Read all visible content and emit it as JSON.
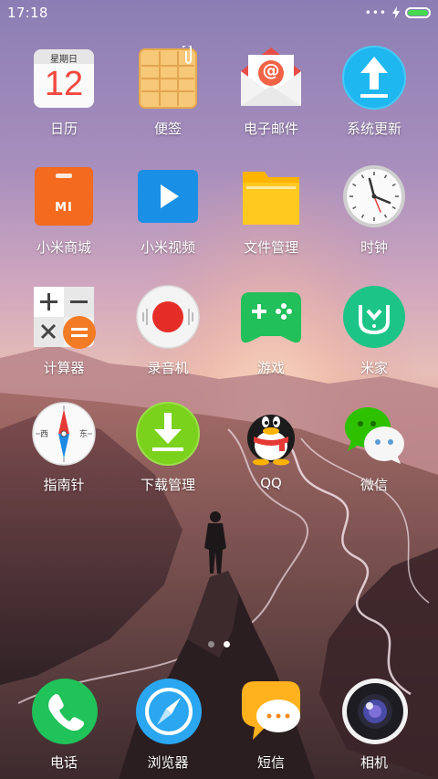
{
  "status_bar": {
    "time": "17:18",
    "signal_dots": "•••",
    "battery_level": 1.0,
    "battery_color": "#44d94f"
  },
  "home_screen": {
    "rows": [
      [
        {
          "label": "日历",
          "icon": "calendar-icon",
          "calendar_weekday": "星期日",
          "calendar_day": "12"
        },
        {
          "label": "便签",
          "icon": "notes-icon"
        },
        {
          "label": "电子邮件",
          "icon": "email-icon",
          "email_symbol": "@"
        },
        {
          "label": "系统更新",
          "icon": "system-update-icon"
        }
      ],
      [
        {
          "label": "小米商城",
          "icon": "mi-store-icon",
          "logo_text": "MI"
        },
        {
          "label": "小米视频",
          "icon": "video-icon"
        },
        {
          "label": "文件管理",
          "icon": "folder-icon"
        },
        {
          "label": "时钟",
          "icon": "clock-icon"
        }
      ],
      [
        {
          "label": "计算器",
          "icon": "calculator-icon"
        },
        {
          "label": "录音机",
          "icon": "recorder-icon"
        },
        {
          "label": "游戏",
          "icon": "game-icon"
        },
        {
          "label": "米家",
          "icon": "mijia-icon"
        }
      ],
      [
        {
          "label": "指南针",
          "icon": "compass-icon",
          "west": "西",
          "east": "东"
        },
        {
          "label": "下载管理",
          "icon": "download-icon"
        },
        {
          "label": "QQ",
          "icon": "qq-icon"
        },
        {
          "label": "微信",
          "icon": "wechat-icon"
        }
      ]
    ]
  },
  "page_indicator": {
    "pages": 2,
    "current": 2
  },
  "dock": [
    {
      "label": "电话",
      "icon": "phone-icon"
    },
    {
      "label": "浏览器",
      "icon": "browser-icon"
    },
    {
      "label": "短信",
      "icon": "messages-icon"
    },
    {
      "label": "相机",
      "icon": "camera-icon"
    }
  ],
  "colors": {
    "mi_orange": "#f46a1f",
    "video_blue": "#1a8fe6",
    "folder_yellow": "#ffc21a",
    "game_green": "#21c05a",
    "mijia_green": "#1cc587",
    "download_green": "#7bd21c",
    "phone_green": "#20c25a",
    "browser_blue": "#2aa7f0",
    "messages_yellow": "#ffb21e"
  }
}
